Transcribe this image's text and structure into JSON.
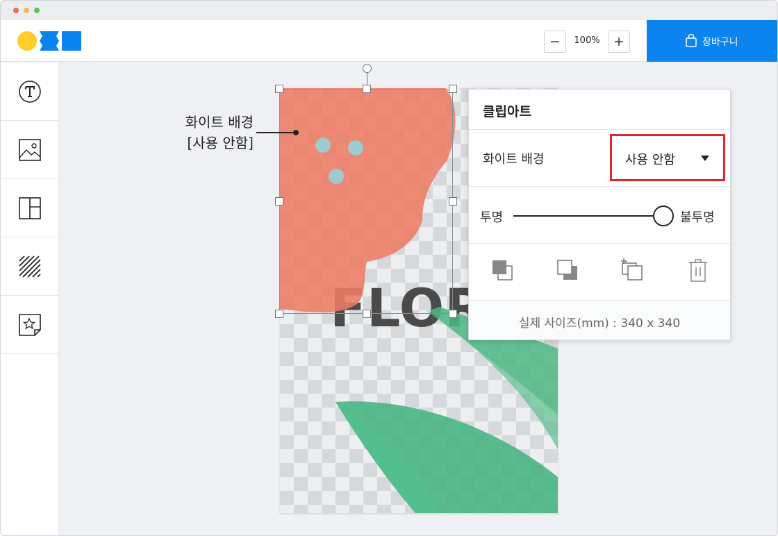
{
  "topbar": {
    "zoom_label": "100%",
    "cart_label": "장바구니"
  },
  "sidebar": {
    "tools": [
      {
        "name": "text-tool",
        "icon": "text-t-icon"
      },
      {
        "name": "image-tool",
        "icon": "image-icon"
      },
      {
        "name": "layout-tool",
        "icon": "layout-icon"
      },
      {
        "name": "pattern-tool",
        "icon": "hatch-pattern-icon"
      },
      {
        "name": "clipart-tool",
        "icon": "star-sticker-icon"
      }
    ]
  },
  "canvas": {
    "design_text": "FLORA",
    "callout_line1": "화이트 배경",
    "callout_line2": "[사용 안함]"
  },
  "panel": {
    "title": "클립아트",
    "white_bg_label": "화이트 배경",
    "white_bg_value": "사용 안함",
    "transparent_label": "투명",
    "opaque_label": "불투명",
    "opacity_fraction": 1.0,
    "actual_size": "실제 사이즈(mm) : 340 x 340",
    "actions": [
      "bring-forward-icon",
      "send-backward-icon",
      "duplicate-icon",
      "trash-icon"
    ]
  },
  "colors": {
    "accent": "#0b84f0",
    "highlight": "#e0272e",
    "logo_yellow": "#ffcc29",
    "flower": "#ed7b63",
    "leaf": "#4cb783"
  }
}
